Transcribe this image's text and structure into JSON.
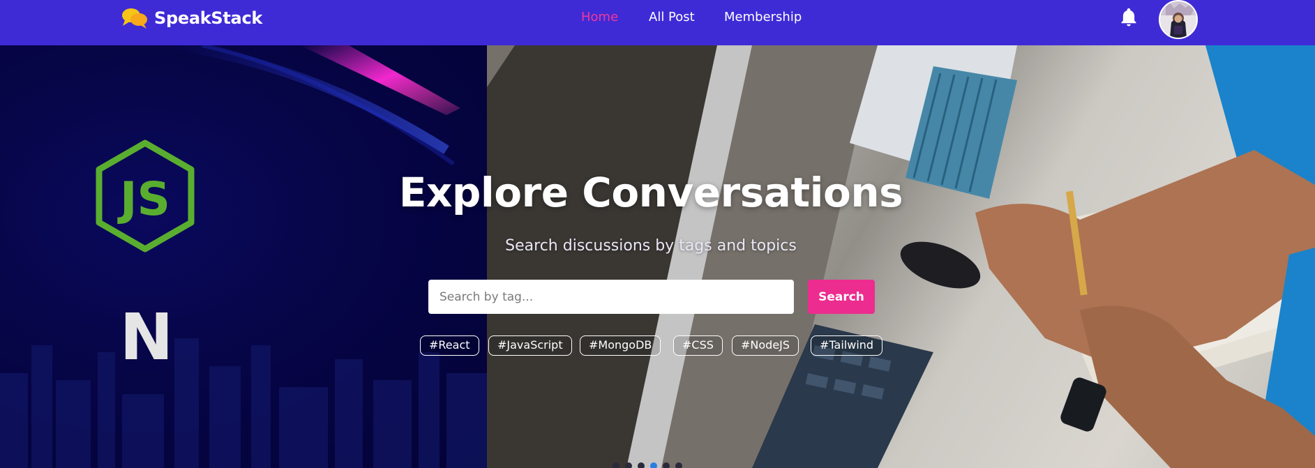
{
  "brand": {
    "name": "SpeakStack",
    "logo_icon": "chat-bubbles-icon"
  },
  "nav": {
    "items": [
      {
        "label": "Home",
        "active": true
      },
      {
        "label": "All Post",
        "active": false
      },
      {
        "label": "Membership",
        "active": false
      }
    ],
    "notification_icon": "bell-icon",
    "avatar": "user-avatar"
  },
  "hero": {
    "title": "Explore Conversations",
    "subtitle": "Search discussions by tags and topics",
    "search": {
      "placeholder": "Search by tag...",
      "value": "",
      "button_label": "Search"
    },
    "tags": [
      "#React",
      "#JavaScript",
      "#MongoDB",
      "#CSS",
      "#NodeJS",
      "#Tailwind"
    ],
    "slider": {
      "slide_count": 6,
      "active_index": 3
    },
    "background_art": {
      "left_slide_logo_text": "JS",
      "left_slide_letter": "N"
    }
  },
  "colors": {
    "navbar_bg": "#3f2bd6",
    "active_link": "#f0379b",
    "search_button": "#ec2c8f",
    "hero_left_bg": "#07064a",
    "nodejs_green": "#5fb832",
    "logo_yellow": "#f5c518"
  }
}
